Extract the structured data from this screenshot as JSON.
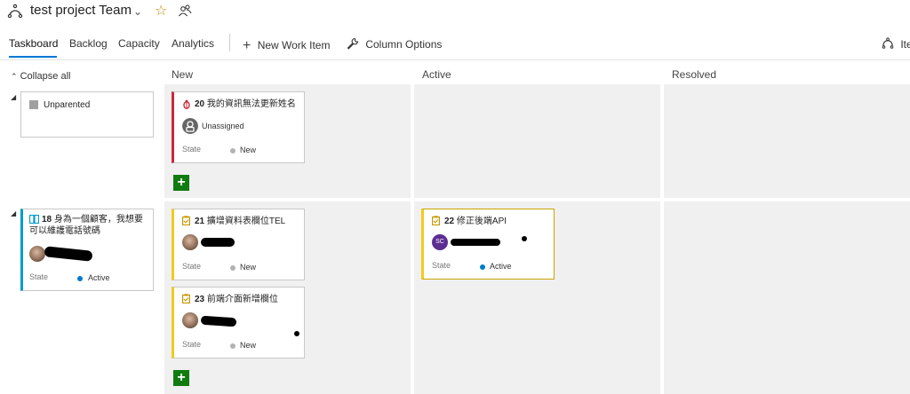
{
  "header": {
    "team_title": "test project Team",
    "favorite_icon": "star-icon",
    "team_members_icon": "people-icon"
  },
  "tabs": [
    {
      "label": "Taskboard",
      "active": true
    },
    {
      "label": "Backlog"
    },
    {
      "label": "Capacity"
    },
    {
      "label": "Analytics"
    }
  ],
  "toolbar": {
    "new_work_item": "New Work Item",
    "column_options": "Column Options",
    "right_truncated": "Ite"
  },
  "board": {
    "collapse_all": "Collapse all",
    "columns": [
      "New",
      "Active",
      "Resolved"
    ],
    "state_label": "State",
    "rows": [
      {
        "parent": {
          "title": "Unparented"
        },
        "cards": [
          {
            "id": "20",
            "title": "我的資訊無法更新姓名",
            "assignee": "Unassigned",
            "state": "New",
            "type": "bug"
          }
        ]
      },
      {
        "parent": {
          "id": "18",
          "title_line1": "身為一個顧客，我想要",
          "title_line2": "可以維護電話號碼",
          "state": "Active"
        },
        "cards": [
          {
            "id": "21",
            "title": "擴增資料表欄位TEL",
            "state": "New",
            "type": "task"
          },
          {
            "id": "23",
            "title": "前端介面新增欄位",
            "state": "New",
            "type": "task"
          },
          {
            "id": "22",
            "title": "修正後端API",
            "state": "Active",
            "type": "task",
            "avatar_initials": "SC"
          }
        ]
      }
    ]
  },
  "colors": {
    "accent": "#0078d4",
    "bug": "#cc293d",
    "task": "#f2cb1d",
    "story": "#009ccc",
    "new_dot": "#b2b2b2",
    "active_dot": "#007acc",
    "add_green": "#107c10"
  }
}
